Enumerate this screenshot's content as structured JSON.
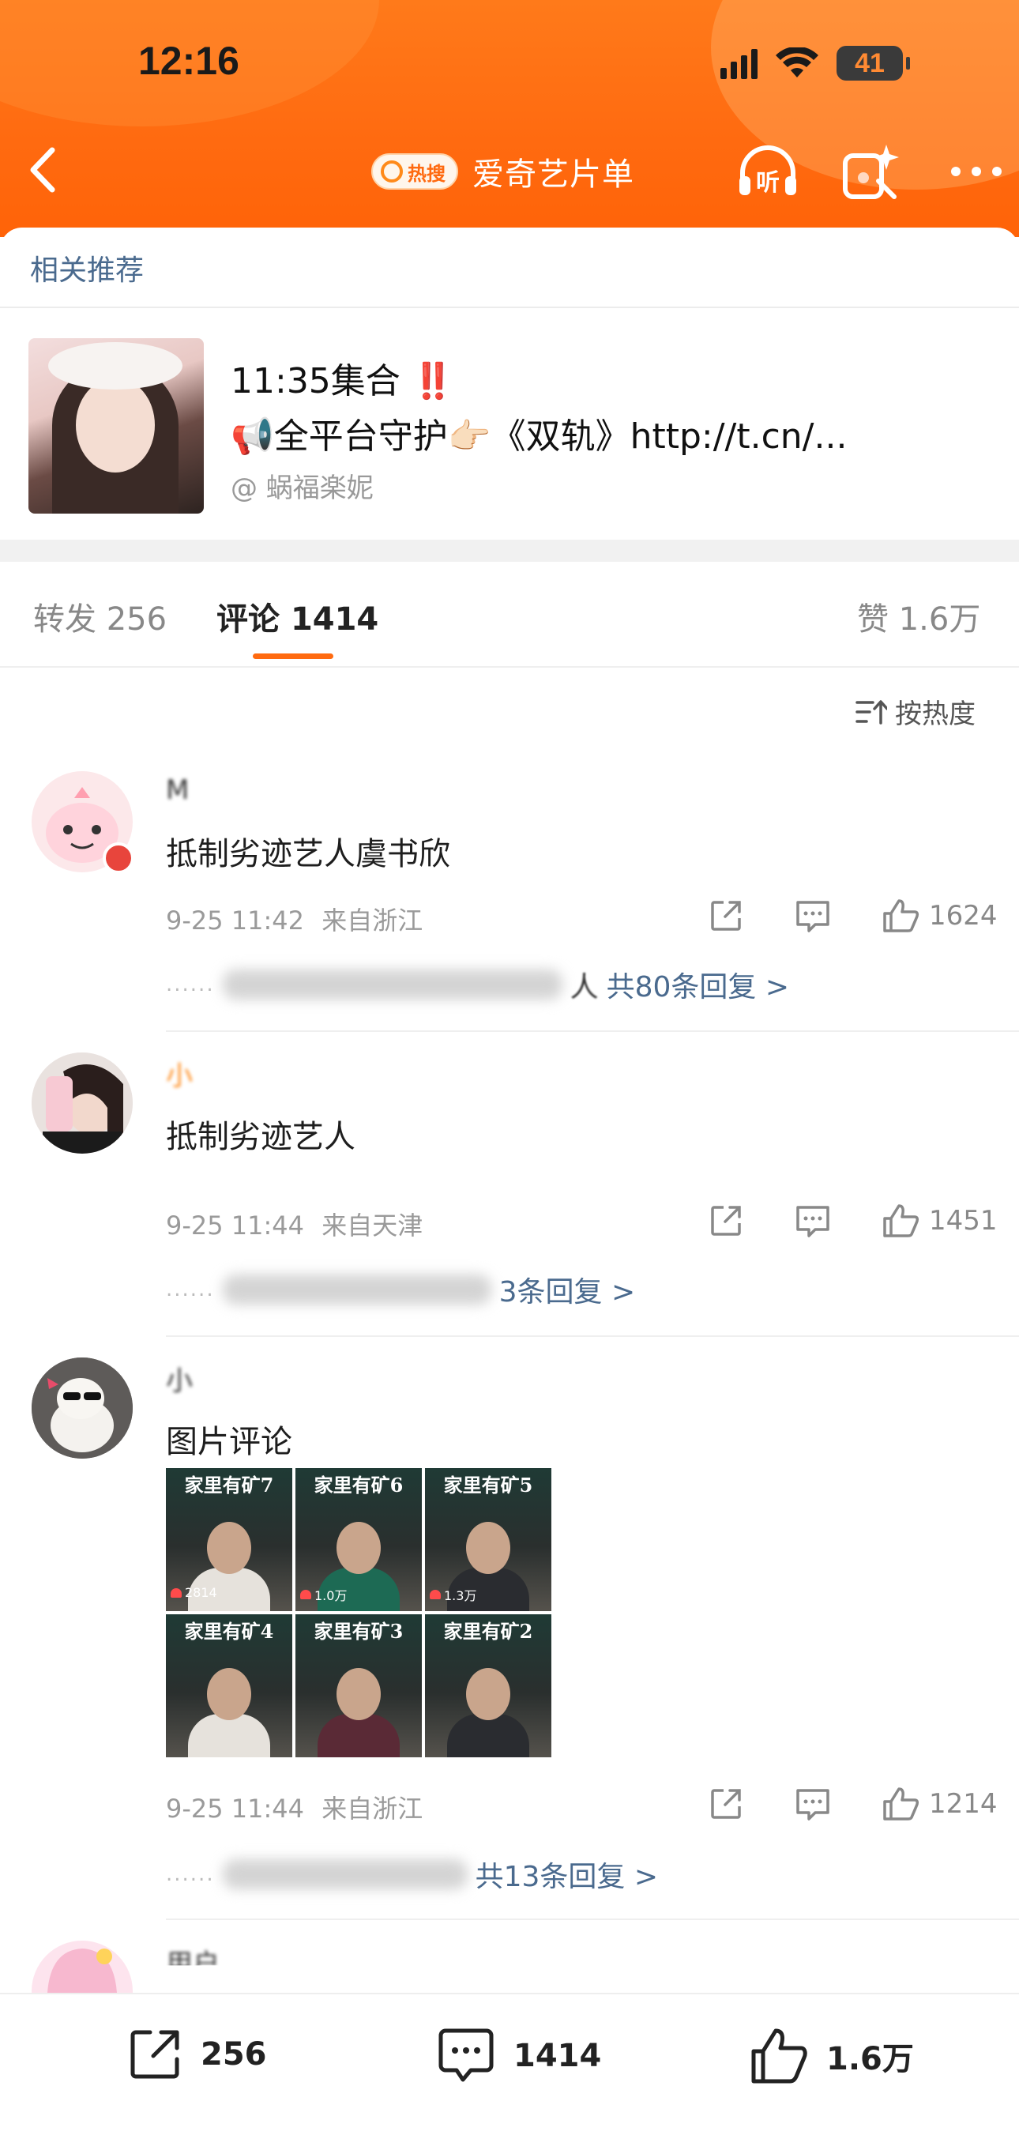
{
  "status_bar": {
    "time": "12:16",
    "battery": "41"
  },
  "nav": {
    "hot_badge": "热搜",
    "title": "爱奇艺片单",
    "listen_label": "听"
  },
  "related": {
    "label": "相关推荐",
    "title": "11:35集合",
    "title_mark": "‼️",
    "desc": "📢全平台守护👉🏻《双轨》http://t.cn/...",
    "author": "@ 蜗福楽妮"
  },
  "tabs": {
    "repost_label": "转发",
    "repost_count": "256",
    "comment_label": "评论",
    "comment_count": "1414",
    "like_label": "赞",
    "like_count": "1.6万"
  },
  "sort_label": "按热度",
  "comments": [
    {
      "user": "M",
      "text": "抵制劣迹艺人虞书欣",
      "time": "9-25 11:42",
      "location": "来自浙江",
      "likes": "1624",
      "reply_text": "共80条回复 >",
      "reply_prefix": "人"
    },
    {
      "user": "小",
      "text": "抵制劣迹艺人",
      "time": "9-25 11:44",
      "location": "来自天津",
      "likes": "1451",
      "reply_text": "3条回复 >"
    },
    {
      "user": "小",
      "text": "图片评论",
      "time": "9-25 11:44",
      "location": "来自浙江",
      "likes": "1214",
      "reply_text": "共13条回复 >",
      "images": [
        {
          "title": "家里有矿7",
          "count": "2814"
        },
        {
          "title": "家里有矿6",
          "count": "1.0万"
        },
        {
          "title": "家里有矿5",
          "count": "1.3万"
        },
        {
          "title": "家里有矿4",
          "count": ""
        },
        {
          "title": "家里有矿3",
          "count": ""
        },
        {
          "title": "家里有矿2",
          "count": ""
        }
      ]
    },
    {
      "user": "用户"
    }
  ],
  "bottom_bar": {
    "repost": "256",
    "comment": "1414",
    "like": "1.6万"
  },
  "colors": {
    "header": "#ff6a10",
    "accent": "#ff6a10",
    "link": "#4a6a8e"
  }
}
